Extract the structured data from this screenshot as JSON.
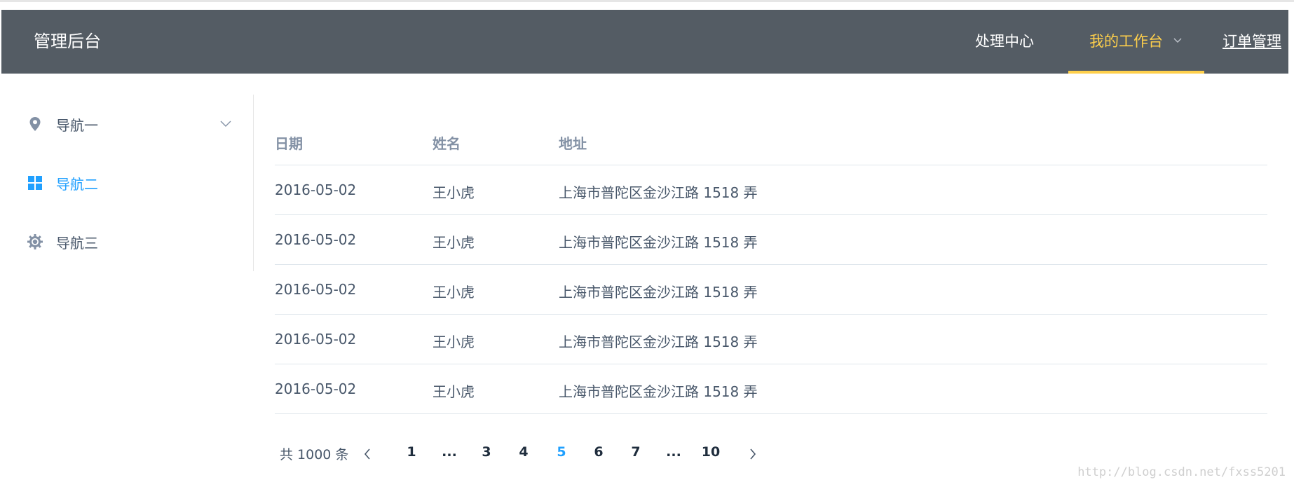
{
  "header": {
    "brand": "管理后台",
    "nav": [
      {
        "label": "处理中心"
      },
      {
        "label": "我的工作台"
      },
      {
        "label": "订单管理"
      }
    ]
  },
  "sidebar": {
    "items": [
      {
        "label": "导航一",
        "icon": "location-pin-icon"
      },
      {
        "label": "导航二",
        "icon": "grid-menu-icon"
      },
      {
        "label": "导航三",
        "icon": "settings-gear-icon"
      }
    ]
  },
  "table": {
    "columns": [
      "日期",
      "姓名",
      "地址"
    ],
    "rows": [
      [
        "2016-05-02",
        "王小虎",
        "上海市普陀区金沙江路 1518 弄"
      ],
      [
        "2016-05-02",
        "王小虎",
        "上海市普陀区金沙江路 1518 弄"
      ],
      [
        "2016-05-02",
        "王小虎",
        "上海市普陀区金沙江路 1518 弄"
      ],
      [
        "2016-05-02",
        "王小虎",
        "上海市普陀区金沙江路 1518 弄"
      ],
      [
        "2016-05-02",
        "王小虎",
        "上海市普陀区金沙江路 1518 弄"
      ]
    ]
  },
  "pagination": {
    "total": "共 1000 条",
    "pages": [
      "1",
      "...",
      "3",
      "4",
      "5",
      "6",
      "7",
      "...",
      "10"
    ],
    "current": "5"
  },
  "watermark": "http://blog.csdn.net/fxss5201",
  "colors": {
    "header_bg": "#545c64",
    "active_nav": "#ffd04b",
    "accent": "#20a0ff"
  }
}
